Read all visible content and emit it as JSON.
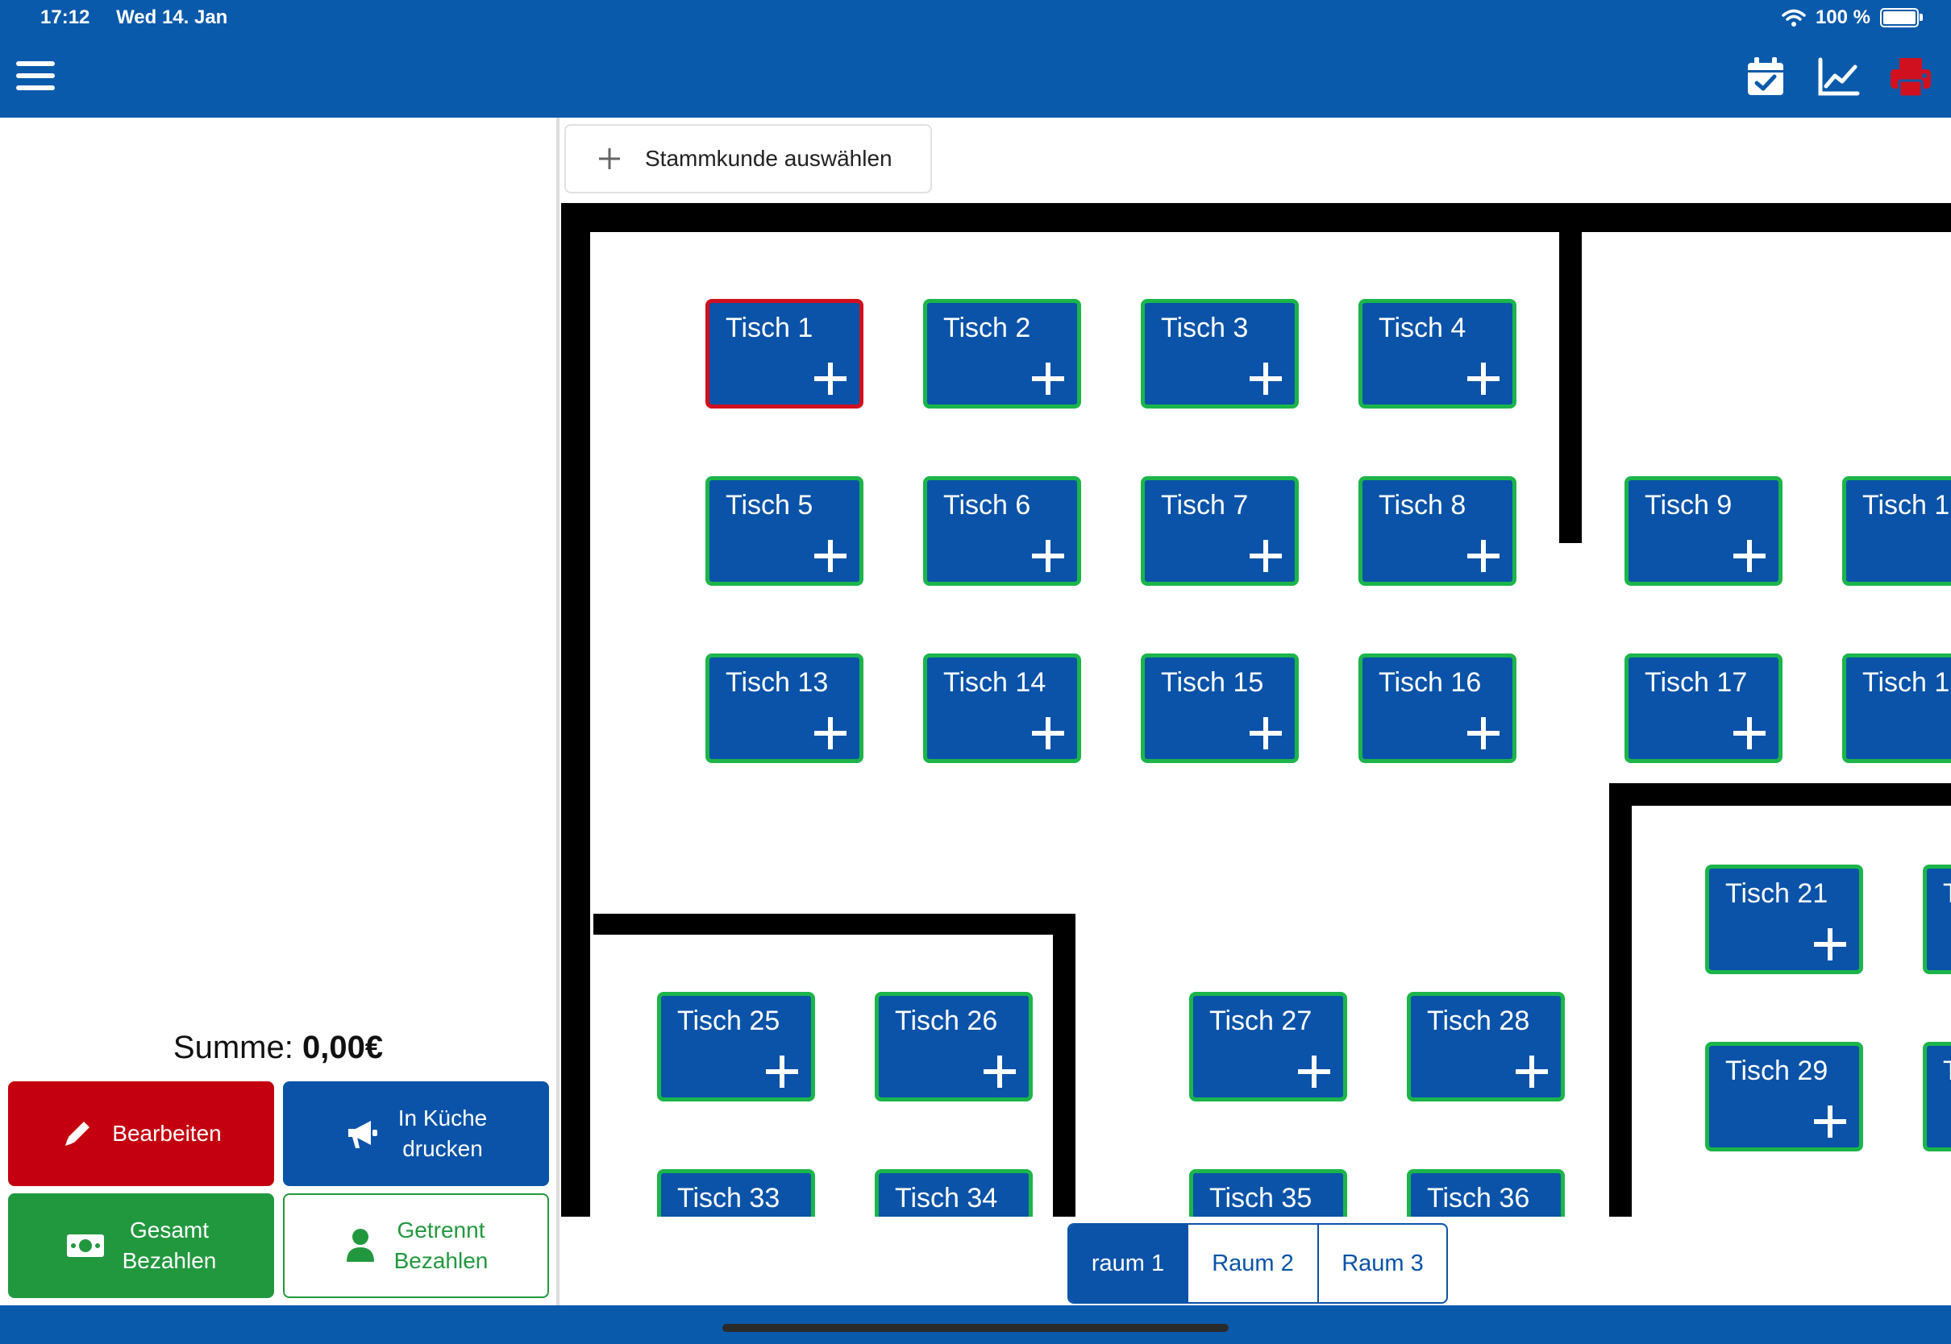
{
  "status_bar": {
    "time": "17:12",
    "date": "Wed 14. Jan",
    "battery": "100 %"
  },
  "colors": {
    "primary": "#0a5aab",
    "table_bg": "#0a53a8",
    "table_border_free": "#1bb54a",
    "table_border_selected": "#d0101e",
    "danger": "#c40010",
    "success": "#22983e"
  },
  "header": {
    "icons": [
      "menu-icon",
      "calendar-check-icon",
      "chart-line-icon",
      "printer-icon"
    ]
  },
  "customer": {
    "label": "Stammkunde auswählen"
  },
  "summary": {
    "label": "Summe:",
    "value": "0,00€"
  },
  "actions": {
    "edit": "Bearbeiten",
    "kitchen_line1": "In Küche",
    "kitchen_line2": "drucken",
    "pay_all_line1": "Gesamt",
    "pay_all_line2": "Bezahlen",
    "pay_split_line1": "Getrennt",
    "pay_split_line2": "Bezahlen"
  },
  "tables": [
    "Tisch 1",
    "Tisch 2",
    "Tisch 3",
    "Tisch 4",
    "Tisch 5",
    "Tisch 6",
    "Tisch 7",
    "Tisch 8",
    "Tisch 9",
    "Tisch 1",
    "Tisch 13",
    "Tisch 14",
    "Tisch 15",
    "Tisch 16",
    "Tisch 17",
    "Tisch 1",
    "Tisch 21",
    "T",
    "Tisch 29",
    "T",
    "Tisch 25",
    "Tisch 26",
    "Tisch 27",
    "Tisch 28",
    "Tisch 33",
    "Tisch 34",
    "Tisch 35",
    "Tisch 36"
  ],
  "selected_table": "Tisch 1",
  "rooms": [
    "raum 1",
    "Raum 2",
    "Raum 3"
  ],
  "active_room": "raum 1"
}
